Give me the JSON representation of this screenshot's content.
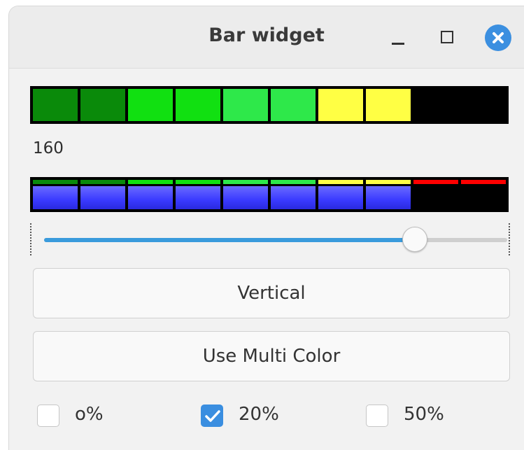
{
  "window": {
    "title": "Bar widget",
    "minimize_icon": "minimize-icon",
    "maximize_icon": "maximize-icon",
    "close_icon": "close-icon",
    "accent_color": "#3b8fe0"
  },
  "top_bar": {
    "segment_colors": [
      "#0a8a0a",
      "#0a8a0a",
      "#11e011",
      "#11e011",
      "#2ee84a",
      "#2ee84a",
      "#ffff44",
      "#ffff44",
      "#000000",
      "#000000"
    ],
    "lit_segments": 8,
    "total_segments": 10
  },
  "value_label": "160",
  "multi_bar": {
    "top_strip_colors": [
      "#0a8a0a",
      "#0a8a0a",
      "#11e011",
      "#11e011",
      "#2ee84a",
      "#2ee84a",
      "#ffff44",
      "#ffff44",
      "#ff0000",
      "#ff0000"
    ],
    "fill_color": "#3a3aff",
    "lit_segments": 8,
    "total_segments": 10
  },
  "slider": {
    "value_fraction": 0.8,
    "fill_color": "#3a9bdc"
  },
  "buttons": {
    "vertical_label": "Vertical",
    "multi_color_label": "Use Multi Color"
  },
  "checkboxes": [
    {
      "label": "o%",
      "checked": false
    },
    {
      "label": "20%",
      "checked": true
    },
    {
      "label": "50%",
      "checked": false
    }
  ]
}
